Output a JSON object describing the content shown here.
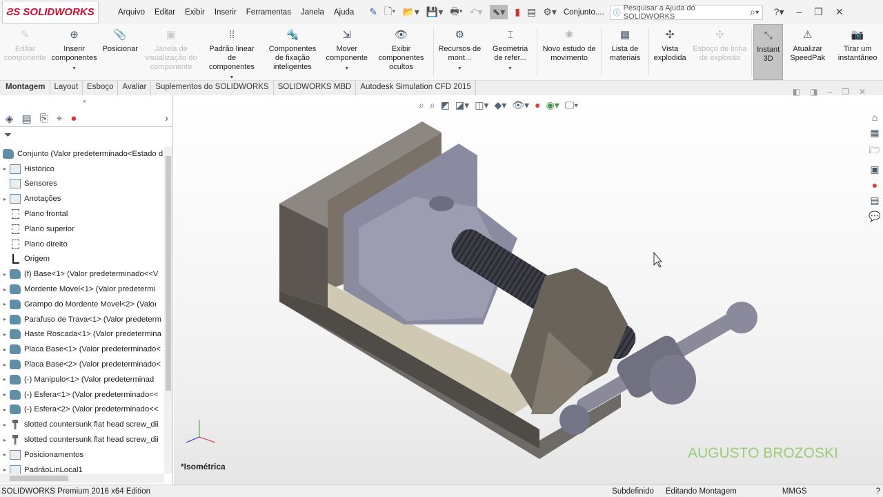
{
  "app": {
    "brand": "SOLIDWORKS",
    "doc_title": "Conjunto....",
    "search_placeholder": "Pesquisar a Ajuda do SOLIDWORKS"
  },
  "menu": [
    "Arquivo",
    "Editar",
    "Exibir",
    "Inserir",
    "Ferramentas",
    "Janela",
    "Ajuda"
  ],
  "ribbon": [
    {
      "label": "Editar componente",
      "disabled": true
    },
    {
      "label": "Inserir componentes",
      "dropdown": true
    },
    {
      "label": "Posicionar"
    },
    {
      "label": "Janela de visualização do componente",
      "disabled": true
    },
    {
      "label": "Padrão linear de componentes",
      "dropdown": true
    },
    {
      "label": "Componentes de fixação inteligentes"
    },
    {
      "label": "Mover componente",
      "dropdown": true
    },
    {
      "label": "Exibir componentes ocultos"
    },
    {
      "label": "Recursos de mont...",
      "dropdown": true
    },
    {
      "label": "Geometria de refer...",
      "dropdown": true
    },
    {
      "label": "Novo estudo de movimento"
    },
    {
      "label": "Lista de materiais"
    },
    {
      "label": "Vista explodida"
    },
    {
      "label": "Esboço de linha de explosão",
      "disabled": true
    },
    {
      "label": "Instant 3D",
      "active": true
    },
    {
      "label": "Atualizar SpeedPak"
    },
    {
      "label": "Tirar um instantâneo"
    }
  ],
  "tabs": [
    "Montagem",
    "Layout",
    "Esboço",
    "Avaliar",
    "Suplementos do SOLIDWORKS",
    "SOLIDWORKS MBD",
    "Autodesk Simulation CFD 2015"
  ],
  "tree": [
    {
      "label": "Conjunto  (Valor predeterminado<Estado d",
      "icon": "assembly",
      "root": true
    },
    {
      "label": "Histórico",
      "icon": "folder",
      "expand": true
    },
    {
      "label": "Sensores",
      "icon": "folder"
    },
    {
      "label": "Anotações",
      "icon": "folder",
      "expand": true
    },
    {
      "label": "Plano frontal",
      "icon": "plane"
    },
    {
      "label": "Plano superior",
      "icon": "plane"
    },
    {
      "label": "Plano direito",
      "icon": "plane"
    },
    {
      "label": "Origem",
      "icon": "origin"
    },
    {
      "label": "(f) Base<1> (Valor predeterminado<<V",
      "icon": "part",
      "expand": true
    },
    {
      "label": "Mordente Movel<1> (Valor predetermi",
      "icon": "part",
      "expand": true
    },
    {
      "label": "Grampo do Mordente Movel<2> (Valoı",
      "icon": "part",
      "expand": true
    },
    {
      "label": "Parafuso de Trava<1> (Valor predeterm",
      "icon": "part",
      "expand": true
    },
    {
      "label": "Haste Roscada<1> (Valor predetermina",
      "icon": "part",
      "expand": true
    },
    {
      "label": "Placa Base<1> (Valor predeterminado<",
      "icon": "part",
      "expand": true
    },
    {
      "label": "Placa Base<2> (Valor predeterminado<",
      "icon": "part",
      "expand": true
    },
    {
      "label": "(-) Manipulo<1> (Valor predeterminad",
      "icon": "part",
      "expand": true
    },
    {
      "label": "(-) Esfera<1> (Valor predeterminado<<",
      "icon": "part",
      "expand": true
    },
    {
      "label": "(-) Esfera<2> (Valor predeterminado<<",
      "icon": "part",
      "expand": true
    },
    {
      "label": "slotted countersunk flat head screw_dii",
      "icon": "screw",
      "expand": true
    },
    {
      "label": "slotted countersunk flat head screw_dii",
      "icon": "screw",
      "expand": true
    },
    {
      "label": "Posicionamentos",
      "icon": "mates",
      "expand": true
    },
    {
      "label": "PadrãoLinLocal1",
      "icon": "pattern",
      "expand": true
    }
  ],
  "viewport": {
    "view_name": "*Isométrica",
    "watermark": "AUGUSTO BROZOSKI"
  },
  "status": {
    "edition": "SOLIDWORKS Premium 2016 x64 Edition",
    "state": "Subdefinido",
    "mode": "Editando Montagem",
    "units": "MMGS"
  }
}
